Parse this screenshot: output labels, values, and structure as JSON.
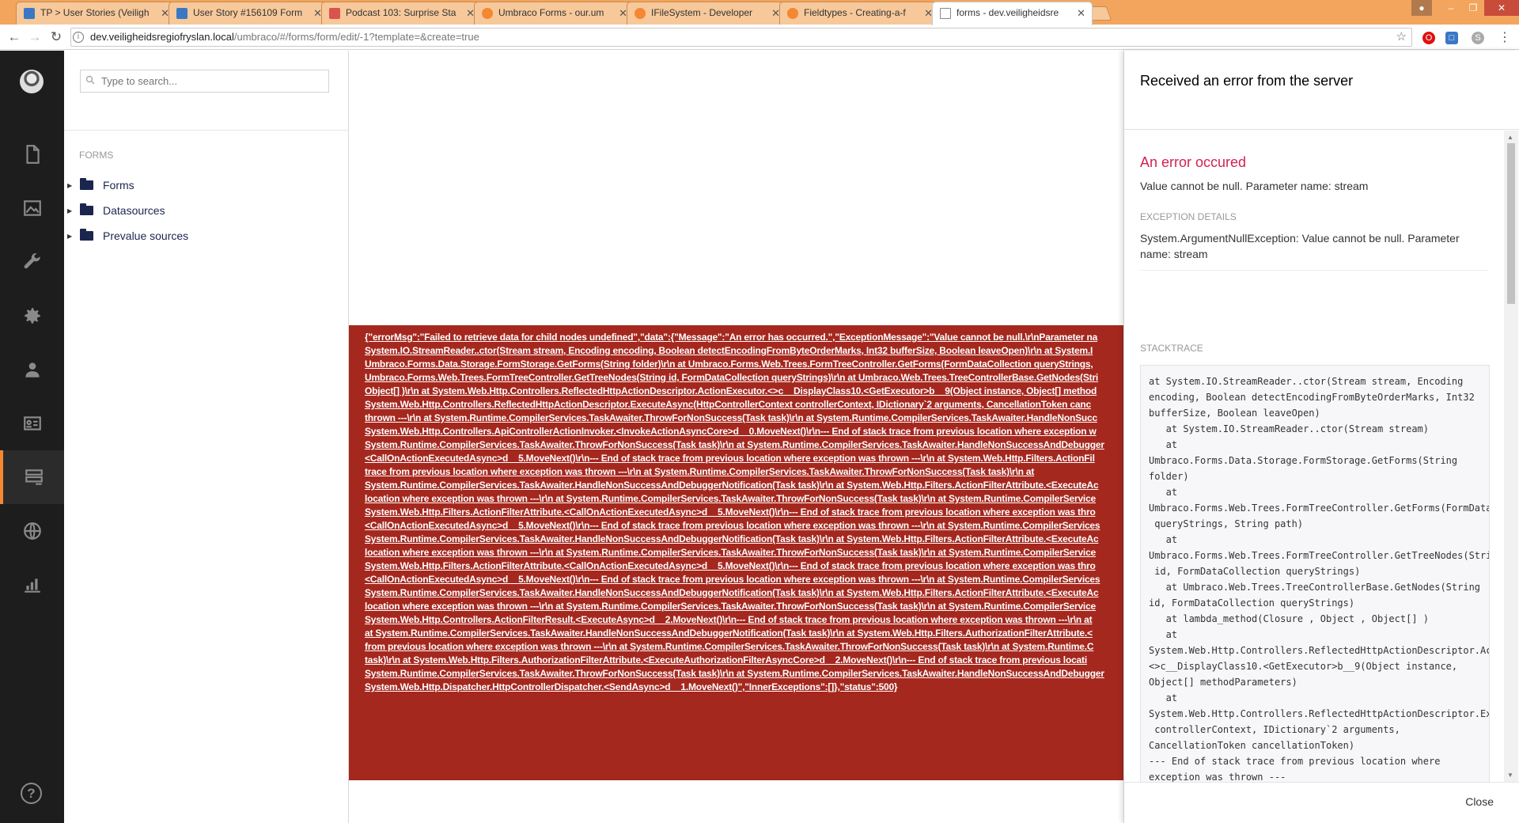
{
  "browser": {
    "tabs": [
      {
        "title": "TP > User Stories (Veiligh",
        "icon": "tp"
      },
      {
        "title": "User Story #156109 Form",
        "icon": "tp"
      },
      {
        "title": "Podcast 103: Surprise Sta",
        "icon": "pod"
      },
      {
        "title": "Umbraco Forms - our.um",
        "icon": "umb"
      },
      {
        "title": "IFileSystem - Developer",
        "icon": "umb"
      },
      {
        "title": "Fieldtypes - Creating-a-f",
        "icon": "umb"
      },
      {
        "title": "forms - dev.veiligheidsre",
        "icon": "doc"
      }
    ],
    "url_host": "dev.veiligheidsregiofryslan.local",
    "url_path": "/umbraco/#/forms/form/edit/-1?template=&create=true"
  },
  "sidebar": {
    "search_placeholder": "Type to search...",
    "tree_title": "FORMS",
    "tree_items": [
      "Forms",
      "Datasources",
      "Prevalue sources"
    ]
  },
  "error_output": [
    "{\"errorMsg\":\"Failed to retrieve data for child nodes undefined\",\"data\":{\"Message\":\"An error has occurred.\",\"ExceptionMessage\":\"Value cannot be null.\\r\\nParameter na",
    "System.IO.StreamReader..ctor(Stream stream, Encoding encoding, Boolean detectEncodingFromByteOrderMarks, Int32 bufferSize, Boolean leaveOpen)\\r\\n at System.I",
    "Umbraco.Forms.Data.Storage.FormStorage.GetForms(String folder)\\r\\n at Umbraco.Forms.Web.Trees.FormTreeController.GetForms(FormDataCollection queryStrings,",
    "Umbraco.Forms.Web.Trees.FormTreeController.GetTreeNodes(String id, FormDataCollection queryStrings)\\r\\n at Umbraco.Web.Trees.TreeControllerBase.GetNodes(Stri",
    "Object[] )\\r\\n at System.Web.Http.Controllers.ReflectedHttpActionDescriptor.ActionExecutor.<>c__DisplayClass10.<GetExecutor>b__9(Object instance, Object[] method",
    "System.Web.Http.Controllers.ReflectedHttpActionDescriptor.ExecuteAsync(HttpControllerContext controllerContext, IDictionary`2 arguments, CancellationToken canc",
    "thrown ---\\r\\n at System.Runtime.CompilerServices.TaskAwaiter.ThrowForNonSuccess(Task task)\\r\\n at System.Runtime.CompilerServices.TaskAwaiter.HandleNonSucc",
    "System.Web.Http.Controllers.ApiControllerActionInvoker.<InvokeActionAsyncCore>d__0.MoveNext()\\r\\n--- End of stack trace from previous location where exception w",
    "System.Runtime.CompilerServices.TaskAwaiter.ThrowForNonSuccess(Task task)\\r\\n at System.Runtime.CompilerServices.TaskAwaiter.HandleNonSuccessAndDebugger",
    "<CallOnActionExecutedAsync>d__5.MoveNext()\\r\\n--- End of stack trace from previous location where exception was thrown ---\\r\\n at System.Web.Http.Filters.ActionFil",
    "trace from previous location where exception was thrown ---\\r\\n at System.Runtime.CompilerServices.TaskAwaiter.ThrowForNonSuccess(Task task)\\r\\n at",
    "System.Runtime.CompilerServices.TaskAwaiter.HandleNonSuccessAndDebuggerNotification(Task task)\\r\\n at System.Web.Http.Filters.ActionFilterAttribute.<ExecuteAc",
    "location where exception was thrown ---\\r\\n at System.Runtime.CompilerServices.TaskAwaiter.ThrowForNonSuccess(Task task)\\r\\n at System.Runtime.CompilerService",
    "System.Web.Http.Filters.ActionFilterAttribute.<CallOnActionExecutedAsync>d__5.MoveNext()\\r\\n--- End of stack trace from previous location where exception was thro",
    "<CallOnActionExecutedAsync>d__5.MoveNext()\\r\\n--- End of stack trace from previous location where exception was thrown ---\\r\\n at System.Runtime.CompilerServices",
    "System.Runtime.CompilerServices.TaskAwaiter.HandleNonSuccessAndDebuggerNotification(Task task)\\r\\n at System.Web.Http.Filters.ActionFilterAttribute.<ExecuteAc",
    "location where exception was thrown ---\\r\\n at System.Runtime.CompilerServices.TaskAwaiter.ThrowForNonSuccess(Task task)\\r\\n at System.Runtime.CompilerService",
    "System.Web.Http.Filters.ActionFilterAttribute.<CallOnActionExecutedAsync>d__5.MoveNext()\\r\\n--- End of stack trace from previous location where exception was thro",
    "<CallOnActionExecutedAsync>d__5.MoveNext()\\r\\n--- End of stack trace from previous location where exception was thrown ---\\r\\n at System.Runtime.CompilerServices",
    "System.Runtime.CompilerServices.TaskAwaiter.HandleNonSuccessAndDebuggerNotification(Task task)\\r\\n at System.Web.Http.Filters.ActionFilterAttribute.<ExecuteAc",
    "location where exception was thrown ---\\r\\n at System.Runtime.CompilerServices.TaskAwaiter.ThrowForNonSuccess(Task task)\\r\\n at System.Runtime.CompilerService",
    "System.Web.Http.Controllers.ActionFilterResult.<ExecuteAsync>d__2.MoveNext()\\r\\n--- End of stack trace from previous location where exception was thrown ---\\r\\n at",
    "at System.Runtime.CompilerServices.TaskAwaiter.HandleNonSuccessAndDebuggerNotification(Task task)\\r\\n at System.Web.Http.Filters.AuthorizationFilterAttribute.<",
    "from previous location where exception was thrown ---\\r\\n at System.Runtime.CompilerServices.TaskAwaiter.ThrowForNonSuccess(Task task)\\r\\n at System.Runtime.C",
    "task)\\r\\n at System.Web.Http.Filters.AuthorizationFilterAttribute.<ExecuteAuthorizationFilterAsyncCore>d__2.MoveNext()\\r\\n--- End of stack trace from previous locati",
    "System.Runtime.CompilerServices.TaskAwaiter.ThrowForNonSuccess(Task task)\\r\\n at System.Runtime.CompilerServices.TaskAwaiter.HandleNonSuccessAndDebugger",
    "System.Web.Http.Dispatcher.HttpControllerDispatcher.<SendAsync>d__1.MoveNext()\",\"InnerExceptions\":[]},\"status\":500}"
  ],
  "dialog": {
    "title": "Received an error from the server",
    "error_heading": "An error occured",
    "error_message": "Value cannot be null. Parameter name: stream",
    "exception_label": "EXCEPTION DETAILS",
    "exception_text": "System.ArgumentNullException: Value cannot be null. Parameter name: stream",
    "stacktrace_label": "STACKTRACE",
    "stacktrace": "at System.IO.StreamReader..ctor(Stream stream, Encoding\nencoding, Boolean detectEncodingFromByteOrderMarks, Int32\nbufferSize, Boolean leaveOpen)\n   at System.IO.StreamReader..ctor(Stream stream)\n   at\nUmbraco.Forms.Data.Storage.FormStorage.GetForms(String\nfolder)\n   at\nUmbraco.Forms.Web.Trees.FormTreeController.GetForms(FormDataC\n queryStrings, String path)\n   at\nUmbraco.Forms.Web.Trees.FormTreeController.GetTreeNodes(Strin\n id, FormDataCollection queryStrings)\n   at Umbraco.Web.Trees.TreeControllerBase.GetNodes(String\nid, FormDataCollection queryStrings)\n   at lambda_method(Closure , Object , Object[] )\n   at\nSystem.Web.Http.Controllers.ReflectedHttpActionDescriptor.Act\n<>c__DisplayClass10.<GetExecutor>b__9(Object instance,\nObject[] methodParameters)\n   at\nSystem.Web.Http.Controllers.ReflectedHttpActionDescriptor.Exe\n controllerContext, IDictionary`2 arguments,\nCancellationToken cancellationToken)\n--- End of stack trace from previous location where\nexception was thrown ---\n   at\nSystem.Runtime.CompilerServices.TaskAwaiter.ThrowForNonSucces\n task)",
    "close_label": "Close"
  },
  "colors": {
    "accent": "#f58732",
    "error_bg": "#a5281f",
    "error_heading": "#d42054",
    "nav_bg": "#1d1d1d"
  }
}
